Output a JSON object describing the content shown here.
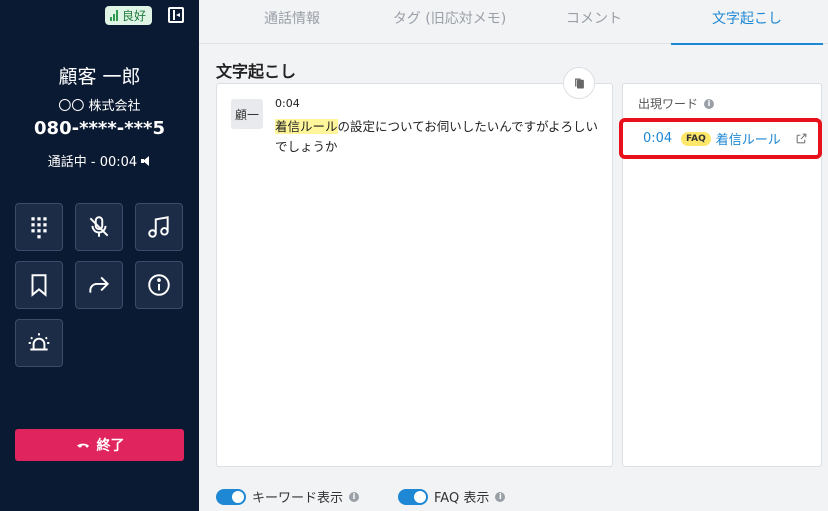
{
  "left_panel": {
    "signal_label": "良好",
    "caller_name": "顧客 一郎",
    "company": "〇〇 株式会社",
    "phone_number": "080-****-***5",
    "call_status": "通話中 - 00:04",
    "controls": [
      "dialpad-icon",
      "mic-off-icon",
      "music-icon",
      "bookmark-icon",
      "transfer-icon",
      "info-icon",
      "alarm-icon"
    ],
    "end_button_label": "終了"
  },
  "tabs": [
    {
      "label": "通話情報",
      "active": false
    },
    {
      "label": "タグ (旧応対メモ)",
      "active": false
    },
    {
      "label": "コメント",
      "active": false
    },
    {
      "label": "文字起こし",
      "active": true
    }
  ],
  "transcript": {
    "title": "文字起こし",
    "messages": [
      {
        "speaker": "顧一",
        "time": "0:04",
        "highlight": "着信ルール",
        "text": "の設定についてお伺いしたいんですがよろしいでしょうか"
      }
    ]
  },
  "words": {
    "title": "出現ワード",
    "items": [
      {
        "time": "0:04",
        "badge": "FAQ",
        "label": "着信ルール"
      }
    ]
  },
  "toggles": [
    {
      "label": "キーワード表示",
      "on": true
    },
    {
      "label": "FAQ 表示",
      "on": true
    }
  ],
  "colors": {
    "sidebar_bg": "#0b1a33",
    "accent": "#1e88d4",
    "end_call": "#e0245e",
    "highlight": "#fff59a",
    "focus_outline": "#e8101a"
  }
}
